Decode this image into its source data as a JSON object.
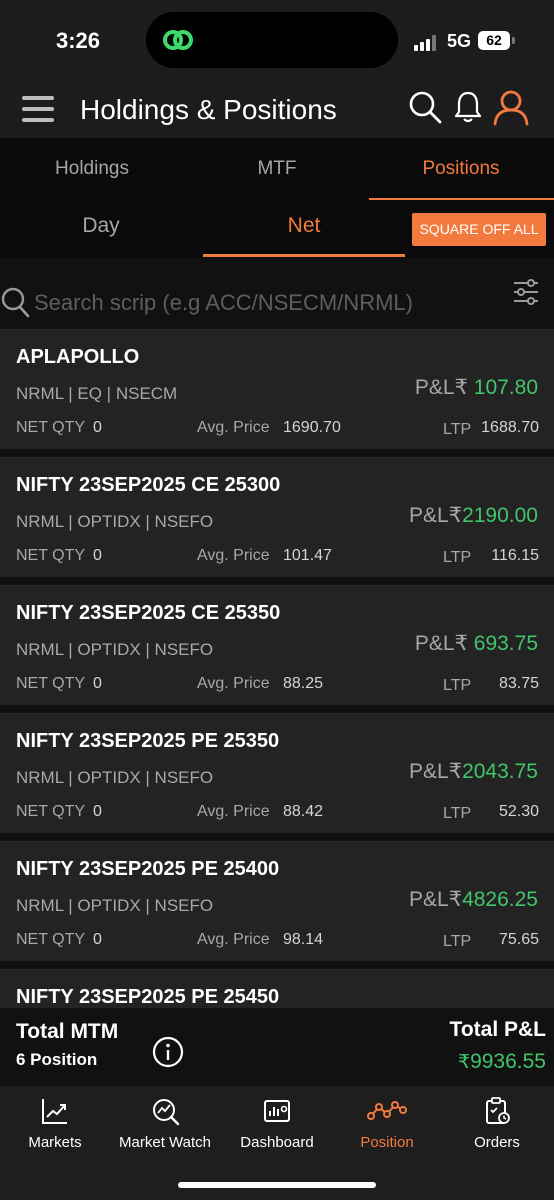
{
  "status_bar": {
    "time": "3:26",
    "network": "5G",
    "battery": "62"
  },
  "header": {
    "title": "Holdings & Positions"
  },
  "tabs": [
    {
      "label": "Holdings",
      "active": false
    },
    {
      "label": "MTF",
      "active": false
    },
    {
      "label": "Positions",
      "active": true
    }
  ],
  "subtabs": [
    {
      "label": "Day",
      "active": false
    },
    {
      "label": "Net",
      "active": true
    }
  ],
  "square_off_label": "SQUARE OFF ALL",
  "search": {
    "placeholder": "Search scrip (e.g ACC/NSECM/NRML)"
  },
  "labels": {
    "pl": "P&L",
    "rupee": "₹",
    "net_qty": "NET QTY",
    "avg_price": "Avg. Price",
    "ltp": "LTP"
  },
  "positions": [
    {
      "name": "APLAPOLLO",
      "product": "NRML | EQ |  NSECM",
      "pl": "107.80",
      "net_qty": "0",
      "avg_price": "1690.70",
      "ltp": "1688.70"
    },
    {
      "name": "NIFTY 23SEP2025 CE 25300",
      "product": "NRML | OPTIDX |  NSEFO",
      "pl": "2190.00",
      "net_qty": "0",
      "avg_price": "101.47",
      "ltp": "116.15"
    },
    {
      "name": "NIFTY 23SEP2025 CE 25350",
      "product": "NRML | OPTIDX |  NSEFO",
      "pl": "693.75",
      "net_qty": "0",
      "avg_price": "88.25",
      "ltp": "83.75"
    },
    {
      "name": "NIFTY 23SEP2025 PE 25350",
      "product": "NRML | OPTIDX |  NSEFO",
      "pl": "2043.75",
      "net_qty": "0",
      "avg_price": "88.42",
      "ltp": "52.30"
    },
    {
      "name": "NIFTY 23SEP2025 PE 25400",
      "product": "NRML | OPTIDX |  NSEFO",
      "pl": "4826.25",
      "net_qty": "0",
      "avg_price": "98.14",
      "ltp": "75.65"
    },
    {
      "name": "NIFTY 23SEP2025 PE 25450"
    }
  ],
  "summary": {
    "mtm_title": "Total MTM",
    "position_count": "6 Position",
    "pl_title": "Total P&L",
    "pl_currency": "₹",
    "pl_value": "9936.55"
  },
  "bottom_nav": [
    {
      "label": "Markets",
      "icon": "markets-icon",
      "active": false
    },
    {
      "label": "Market Watch",
      "icon": "market-watch-icon",
      "active": false
    },
    {
      "label": "Dashboard",
      "icon": "dashboard-icon",
      "active": false
    },
    {
      "label": "Position",
      "icon": "position-icon",
      "active": true
    },
    {
      "label": "Orders",
      "icon": "orders-icon",
      "active": false
    }
  ],
  "colors": {
    "accent": "#f37a3e",
    "profit": "#42c46a",
    "card": "#232323",
    "background": "#111111"
  }
}
